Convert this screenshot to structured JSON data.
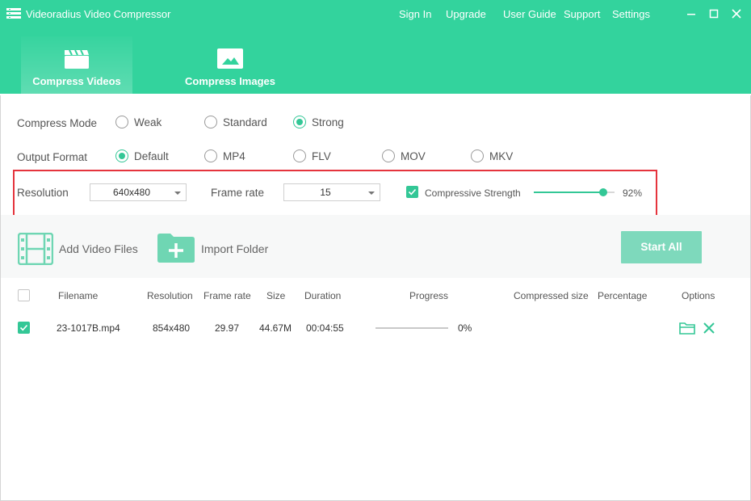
{
  "app": {
    "title": "Videoradius Video Compressor"
  },
  "topnav": [
    "Sign In",
    "Upgrade",
    "User Guide",
    "Support",
    "Settings"
  ],
  "window_controls": [
    "minimize-icon",
    "maximize-icon",
    "close-icon"
  ],
  "tabs": [
    {
      "label": "Compress Videos",
      "icon": "clapperboard-icon",
      "active": true
    },
    {
      "label": "Compress Images",
      "icon": "image-icon",
      "active": false
    }
  ],
  "compress_mode": {
    "label": "Compress Mode",
    "options": [
      "Weak",
      "Standard",
      "Strong"
    ],
    "selected": "Strong"
  },
  "output_format": {
    "label": "Output Format",
    "options": [
      "Default",
      "MP4",
      "FLV",
      "MOV",
      "MKV"
    ],
    "selected": "Default"
  },
  "resolution": {
    "label": "Resolution",
    "value": "640x480"
  },
  "frame_rate": {
    "label": "Frame rate",
    "value": "15"
  },
  "compressive_strength": {
    "label": "Compressive Strength",
    "checked": true,
    "value": "92%",
    "fraction": 0.86
  },
  "toolbar": {
    "add_video_files": "Add Video Files",
    "import_folder": "Import Folder",
    "start_all": "Start All"
  },
  "table": {
    "columns": [
      "Filename",
      "Resolution",
      "Frame rate",
      "Size",
      "Duration",
      "Progress",
      "Compressed size",
      "Percentage",
      "Options"
    ],
    "rows": [
      {
        "checked": true,
        "filename": "23-1017B.mp4",
        "resolution": "854x480",
        "frame_rate": "29.97",
        "size": "44.67M",
        "duration": "00:04:55",
        "progress": "0%",
        "progress_fraction": 0,
        "compressed_size": "",
        "percentage": ""
      }
    ]
  },
  "colors": {
    "accent": "#33d39d",
    "highlight": "#e5343d",
    "start_button": "#7ed9bc"
  }
}
